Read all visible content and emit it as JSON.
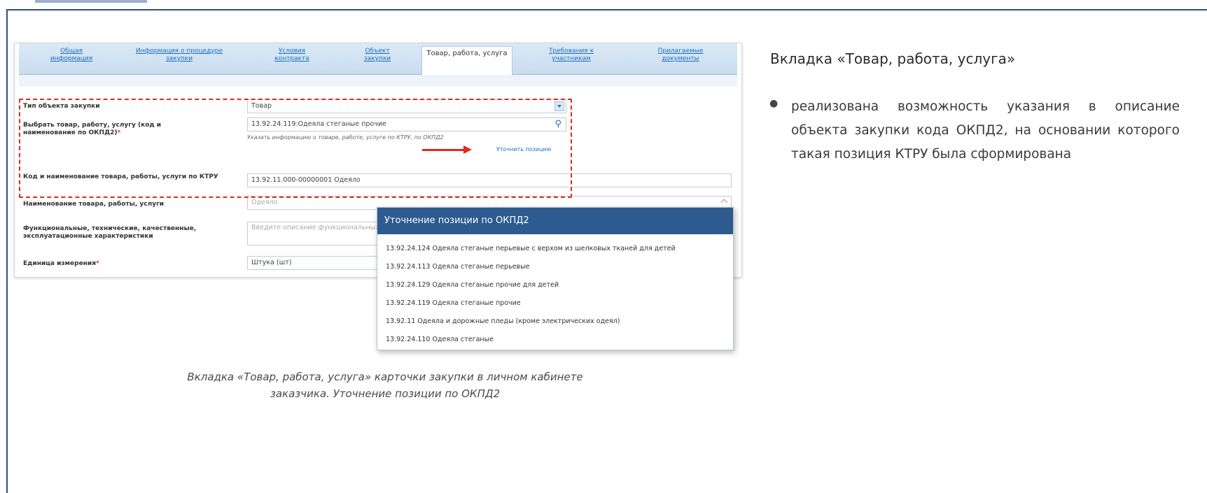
{
  "tabs": [
    {
      "label": "Общая информация"
    },
    {
      "label": "Информация о процедуре закупки"
    },
    {
      "label": "Условия контракта"
    },
    {
      "label": "Объект закупки"
    },
    {
      "label": "Товар, работа, услуга"
    },
    {
      "label": "Требования к участникам"
    },
    {
      "label": "Прилагаемые документы"
    }
  ],
  "form": {
    "object_type_label": "Тип объекта закупки",
    "object_type_value": "Товар",
    "choose_label": "Выбрать товар, работу, услугу (код и наименование по ОКПД2)",
    "required_mark": "*",
    "choose_value": "13.92.24.119:Одеяла стеганые прочие",
    "choose_hint": "Указать информацию о товаре, работе, услуге по КТРУ, по ОКПД2",
    "refine_link": "Уточнить позицию",
    "ktru_label": "Код и наименование товара, работы, услуги по КТРУ",
    "ktru_value": "13.92.11.000-00000001 Одеяло",
    "name_label": "Наименование товара, работы, услуги",
    "name_value": "Одеяло",
    "specs_label": "Функциональные, технические, качественные, эксплуатационные характеристики",
    "specs_placeholder": "Введите описание функциональных",
    "unit_label": "Единица измерения",
    "unit_value": "Штука (шт)"
  },
  "popup": {
    "title": "Уточнение позиции по ОКПД2",
    "items": [
      "13.92.24.124 Одеяла стеганые перьевые с верхом из шелковых тканей для детей",
      "13.92.24.113 Одеяла стеганые перьевые",
      "13.92.24.129 Одеяла стеганые прочие для детей",
      "13.92.24.119 Одеяла стеганые прочие",
      "13.92.11 Одеяла и дорожные пледы (кроме электрических одеял)",
      "13.92.24.110 Одеяла стеганые"
    ]
  },
  "caption": {
    "line1": "Вкладка «Товар, работа, услуга» карточки закупки в личном кабинете",
    "line2": "заказчика. Уточнение позиции по ОКПД2"
  },
  "side": {
    "title": "Вкладка «Товар, работа, услуга»",
    "bullet": "реализована возможность указания в описание объекта закупки кода ОКПД2, на основании которого такая позиция КТРУ была сформирована"
  },
  "colors": {
    "accent": "#2d5a8f",
    "highlight": "#e02a1b",
    "link": "#1a6fc4"
  }
}
